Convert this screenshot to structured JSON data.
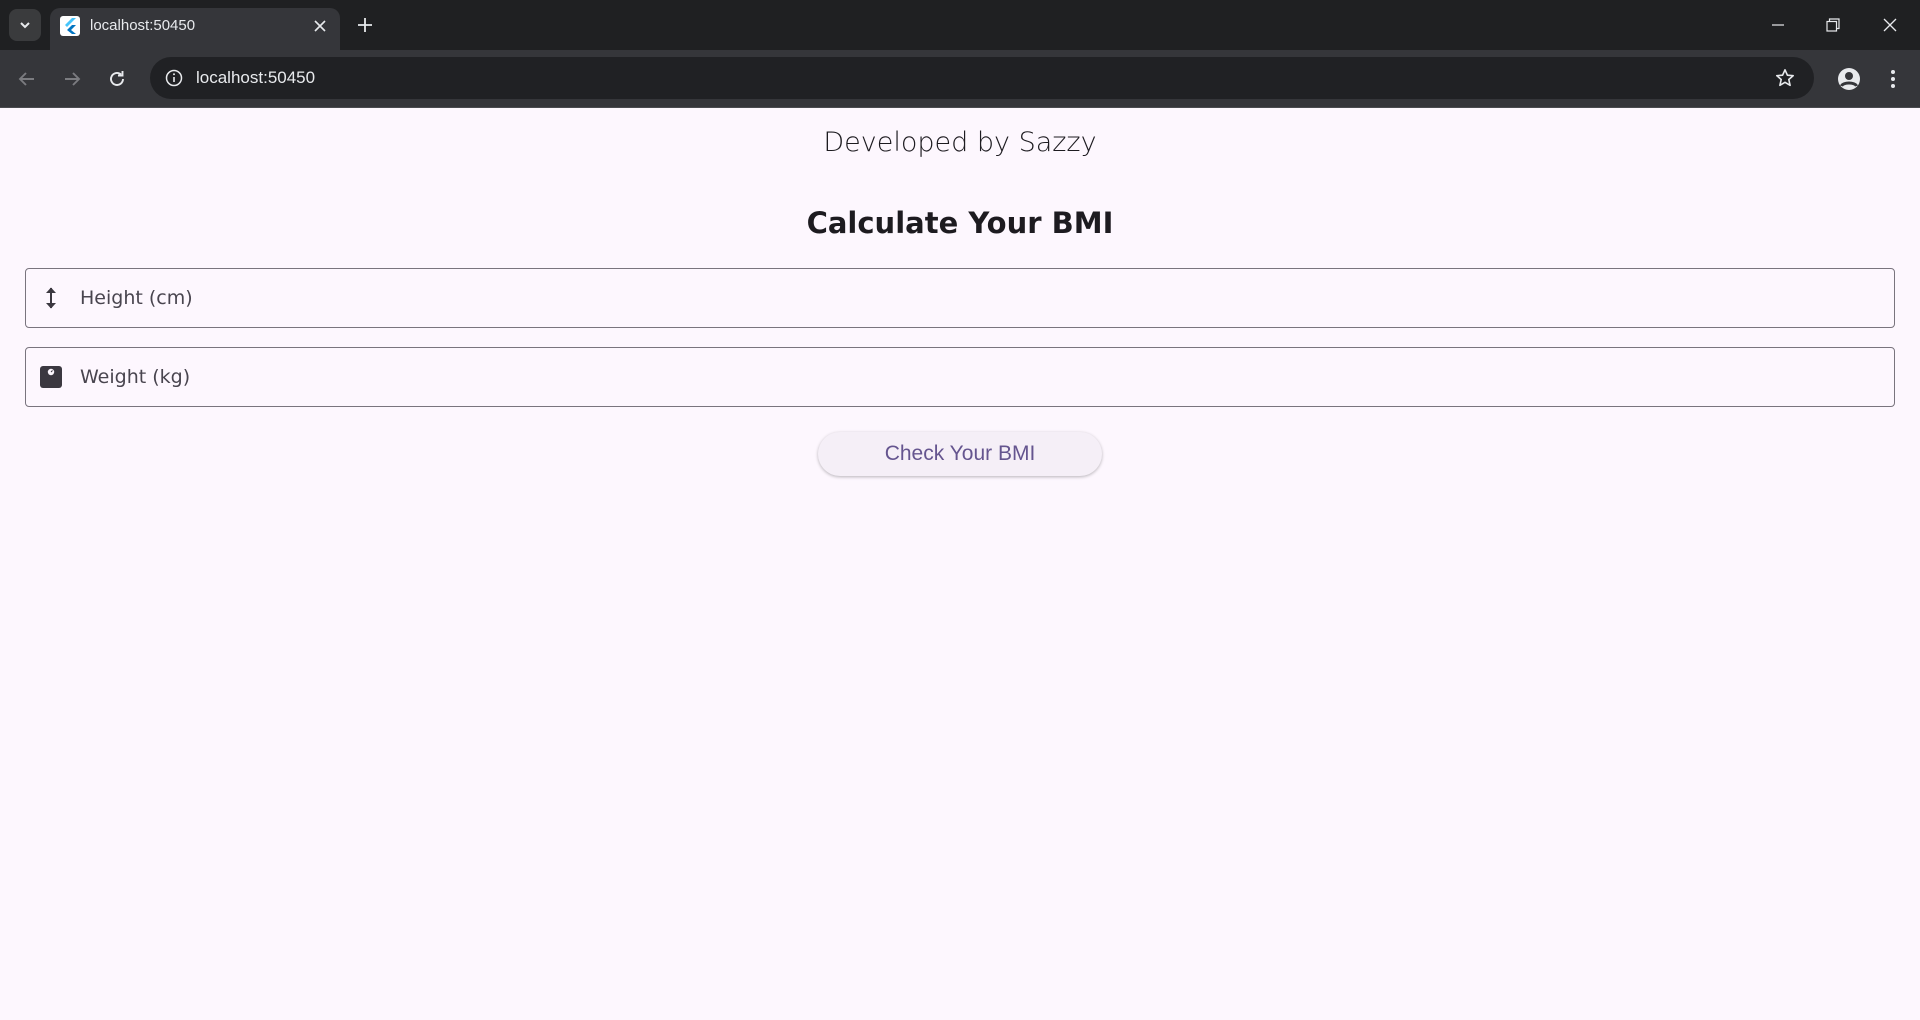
{
  "browser": {
    "tab_title": "localhost:50450",
    "url": "localhost:50450"
  },
  "page": {
    "credit": "Developed by Sazzy",
    "heading": "Calculate Your BMI",
    "height_field": {
      "placeholder": "Height (cm)",
      "value": ""
    },
    "weight_field": {
      "placeholder": "Weight (kg)",
      "value": ""
    },
    "submit_label": "Check Your BMI"
  },
  "colors": {
    "page_background": "#fdf7fe",
    "button_text": "#65558f",
    "button_background": "#f5eff7",
    "field_border": "#79747e"
  },
  "icons": {
    "height": "vertical-arrows-icon",
    "weight": "scale-icon"
  }
}
